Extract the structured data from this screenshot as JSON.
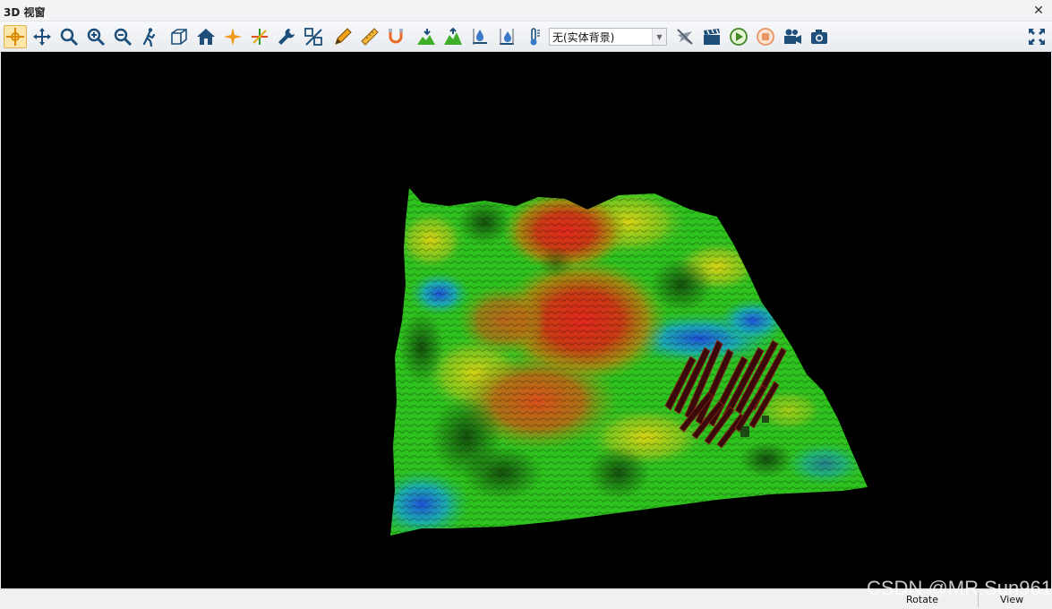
{
  "window": {
    "title": "3D 视窗",
    "close_label": "✕"
  },
  "toolbar": {
    "tools": [
      {
        "icon": "pan-select-icon",
        "active": true
      },
      {
        "icon": "move-icon"
      },
      {
        "icon": "zoom-icon"
      },
      {
        "icon": "zoom-in-icon"
      },
      {
        "icon": "zoom-out-icon"
      },
      {
        "icon": "walk-icon"
      },
      {
        "icon": "cube-icon"
      },
      {
        "icon": "home-icon"
      },
      {
        "icon": "center-point-icon"
      },
      {
        "icon": "axis-icon"
      },
      {
        "icon": "wrench-icon"
      },
      {
        "icon": "scale-ratio-icon"
      },
      {
        "icon": "pencil-icon"
      },
      {
        "icon": "ruler-icon"
      },
      {
        "icon": "magnet-icon"
      },
      {
        "icon": "terrain-lower-icon"
      },
      {
        "icon": "terrain-raise-icon"
      },
      {
        "icon": "water-level-icon"
      },
      {
        "icon": "water-level-2-icon"
      },
      {
        "icon": "thermometer-icon"
      }
    ],
    "background_select": {
      "value": "无(实体背景)"
    },
    "right_tools": [
      {
        "icon": "fly-off-icon"
      },
      {
        "icon": "clapper-icon"
      },
      {
        "icon": "play-icon"
      },
      {
        "icon": "stop-icon"
      },
      {
        "icon": "video-camera-icon"
      },
      {
        "icon": "photo-camera-icon"
      }
    ],
    "fullscreen_icon": "fullscreen-icon"
  },
  "colors": {
    "viewport_bg": "#000000",
    "terrain_low": "#1e5bd6",
    "terrain_mid": "#22c81e",
    "terrain_high": "#d61e14",
    "active_tool": "#fde6a9"
  },
  "status": {
    "rotate": "Rotate",
    "view": "View"
  },
  "watermark": "CSDN @MR.Sun961"
}
